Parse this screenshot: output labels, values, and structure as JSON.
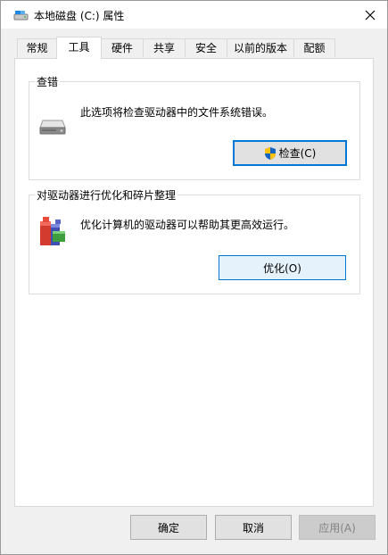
{
  "window": {
    "title": "本地磁盘 (C:) 属性",
    "close_glyph": "✕"
  },
  "tabs": [
    {
      "label": "常规",
      "active": false
    },
    {
      "label": "工具",
      "active": true
    },
    {
      "label": "硬件",
      "active": false
    },
    {
      "label": "共享",
      "active": false
    },
    {
      "label": "安全",
      "active": false
    },
    {
      "label": "以前的版本",
      "active": false
    },
    {
      "label": "配额",
      "active": false
    }
  ],
  "error_check": {
    "title": "查错",
    "description": "此选项将检查驱动器中的文件系统错误。",
    "button_label": "检查(C)",
    "icon": "hard-drive-icon",
    "button_icon": "uac-shield-icon"
  },
  "optimize": {
    "title": "对驱动器进行优化和碎片整理",
    "description": "优化计算机的驱动器可以帮助其更高效运行。",
    "button_label": "优化(O)",
    "icon": "defrag-icon"
  },
  "footer": {
    "ok_label": "确定",
    "cancel_label": "取消",
    "apply_label": "应用(A)"
  },
  "colors": {
    "accent": "#0078d7",
    "dialog_bg": "#f0f0f0",
    "panel_bg": "#ffffff"
  }
}
